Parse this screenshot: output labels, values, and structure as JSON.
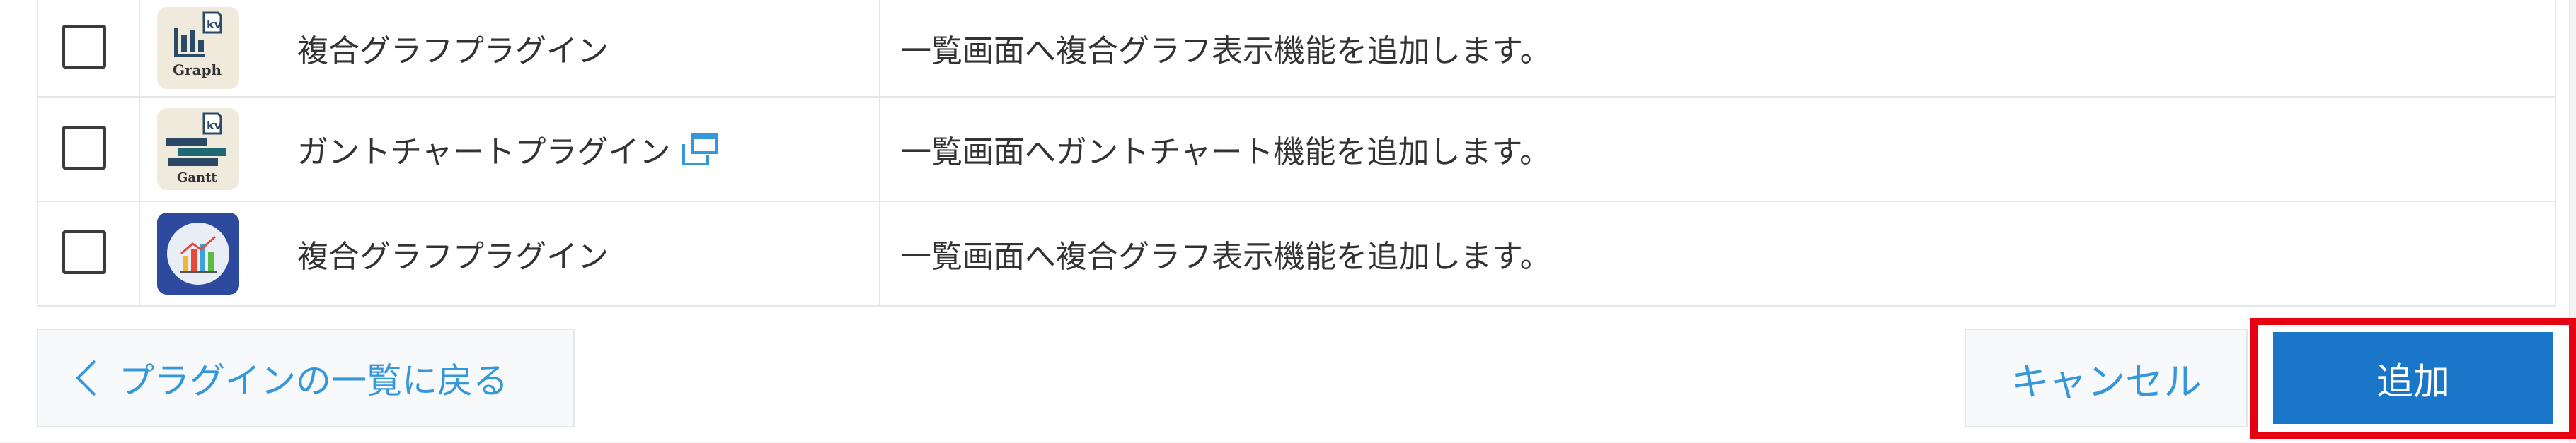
{
  "plugins": [
    {
      "name": "複合グラフプラグイン",
      "description": "一覧画面へ複合グラフ表示機能を追加します。",
      "icon": "graph-kv-icon",
      "icon_label": "Graph",
      "icon_badge": "kv",
      "external_link": false
    },
    {
      "name": "ガントチャートプラグイン",
      "description": "一覧画面へガントチャート機能を追加します。",
      "icon": "gantt-kv-icon",
      "icon_label": "Gantt",
      "icon_badge": "kv",
      "external_link": true
    },
    {
      "name": "複合グラフプラグイン",
      "description": "一覧画面へ複合グラフ表示機能を追加します。",
      "icon": "bar-chart-circle-icon",
      "external_link": false
    }
  ],
  "footer": {
    "back_label": "プラグインの一覧に戻る",
    "cancel_label": "キャンセル",
    "add_label": "追加"
  },
  "colors": {
    "link_blue": "#3498db",
    "primary_button": "#1976c8",
    "highlight_red": "#e60012",
    "border": "#e3e7e8",
    "text": "#333333"
  }
}
